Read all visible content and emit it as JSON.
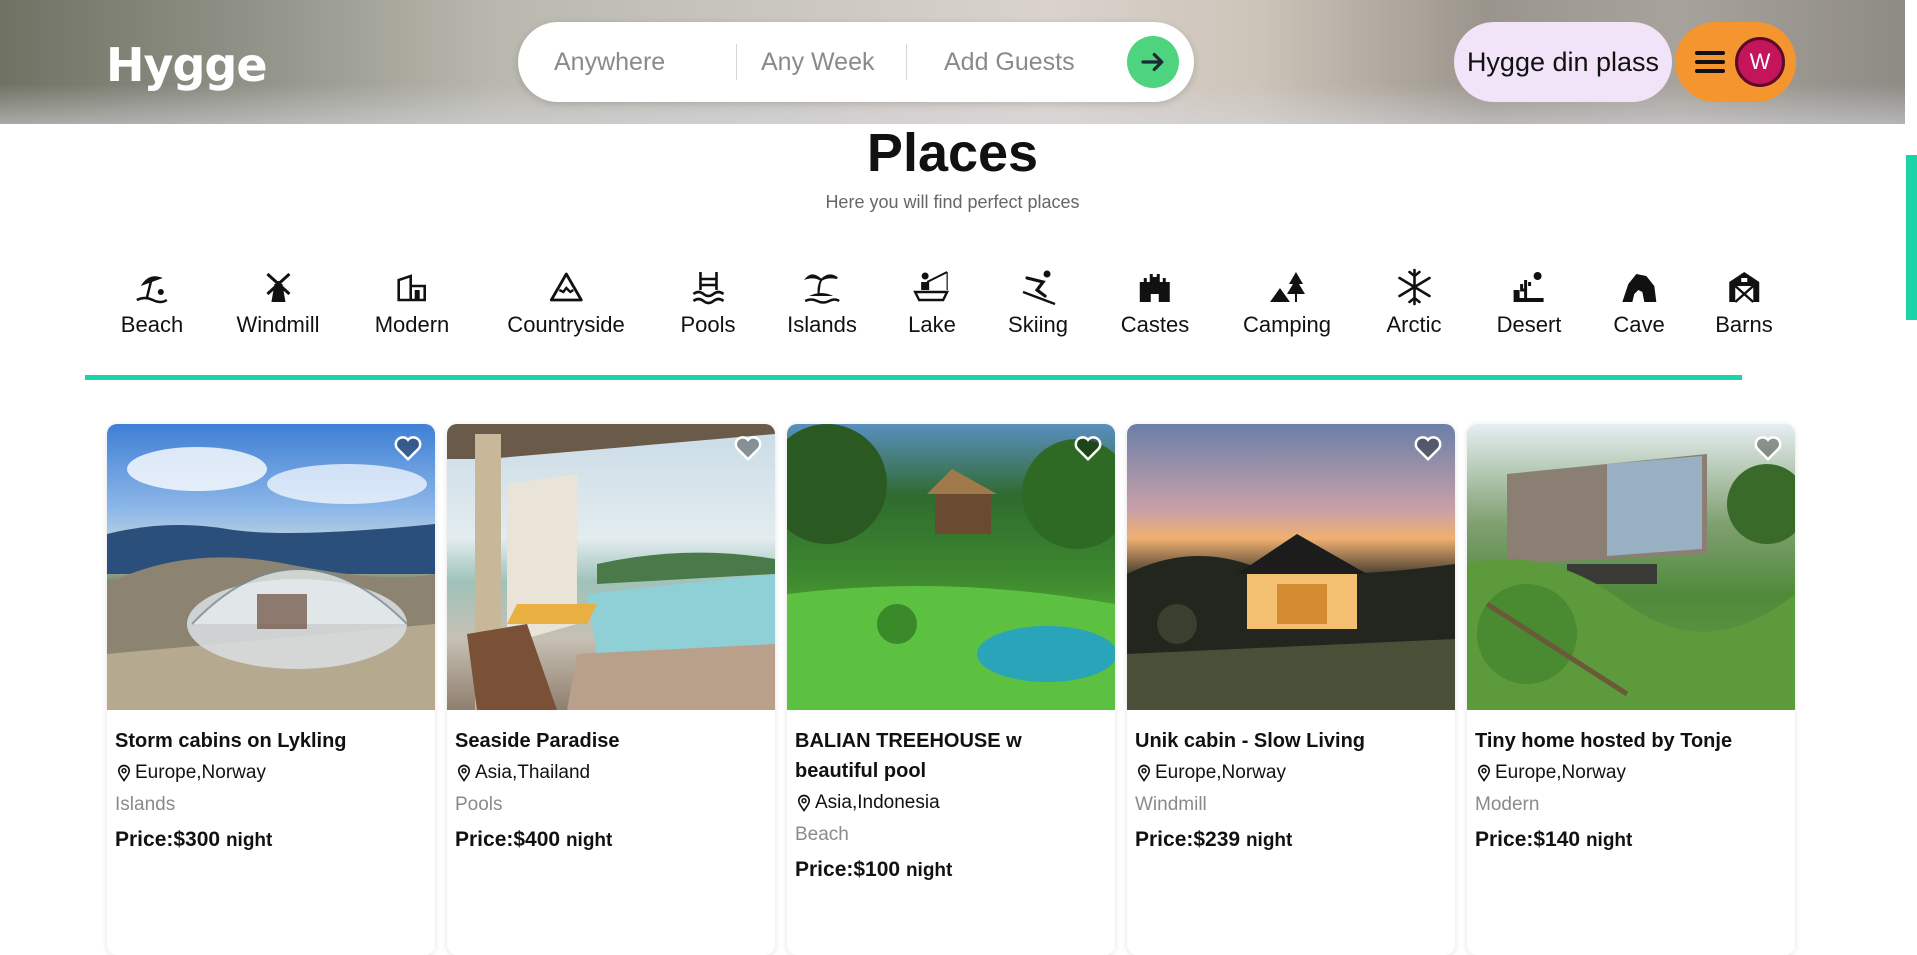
{
  "header": {
    "logo": "Hygge",
    "search": {
      "where": "Anywhere",
      "when": "Any Week",
      "guests": "Add Guests"
    },
    "host_button": "Hygge din plass",
    "avatar_initial": "W"
  },
  "page": {
    "title": "Places",
    "subtitle": "Here you will find perfect places"
  },
  "categories": [
    {
      "label": "Beach",
      "icon": "beach-umbrella-icon"
    },
    {
      "label": "Windmill",
      "icon": "windmill-icon"
    },
    {
      "label": "Modern",
      "icon": "modern-house-icon"
    },
    {
      "label": "Countryside",
      "icon": "mountain-icon"
    },
    {
      "label": "Pools",
      "icon": "pool-ladder-icon"
    },
    {
      "label": "Islands",
      "icon": "island-palm-icon"
    },
    {
      "label": "Lake",
      "icon": "fishing-lake-icon"
    },
    {
      "label": "Skiing",
      "icon": "skier-icon"
    },
    {
      "label": "Castes",
      "icon": "castle-icon"
    },
    {
      "label": "Camping",
      "icon": "camping-tent-icon"
    },
    {
      "label": "Arctic",
      "icon": "snowflake-icon"
    },
    {
      "label": "Desert",
      "icon": "desert-cactus-icon"
    },
    {
      "label": "Cave",
      "icon": "cave-icon"
    },
    {
      "label": "Barns",
      "icon": "barn-icon"
    }
  ],
  "listings": [
    {
      "title": "Storm cabins on Lykling",
      "location": "Europe,Norway",
      "category": "Islands",
      "price": "Price:$300",
      "unit": "night"
    },
    {
      "title": "Seaside Paradise",
      "location": "Asia,Thailand",
      "category": "Pools",
      "price": "Price:$400",
      "unit": "night"
    },
    {
      "title": "BALIAN TREEHOUSE w beautiful pool",
      "location": "Asia,Indonesia",
      "category": "Beach",
      "price": "Price:$100",
      "unit": "night"
    },
    {
      "title": "Unik cabin - Slow Living",
      "location": "Europe,Norway",
      "category": "Windmill",
      "price": "Price:$239",
      "unit": "night"
    },
    {
      "title": "Tiny home hosted by Tonje",
      "location": "Europe,Norway",
      "category": "Modern",
      "price": "Price:$140",
      "unit": "night"
    }
  ],
  "colors": {
    "accent": "#19d4a6",
    "search_go": "#4ed47e",
    "host_button_bg": "#f1e4f8",
    "menu_button_bg": "#f59530",
    "avatar_bg": "#c4145a"
  }
}
